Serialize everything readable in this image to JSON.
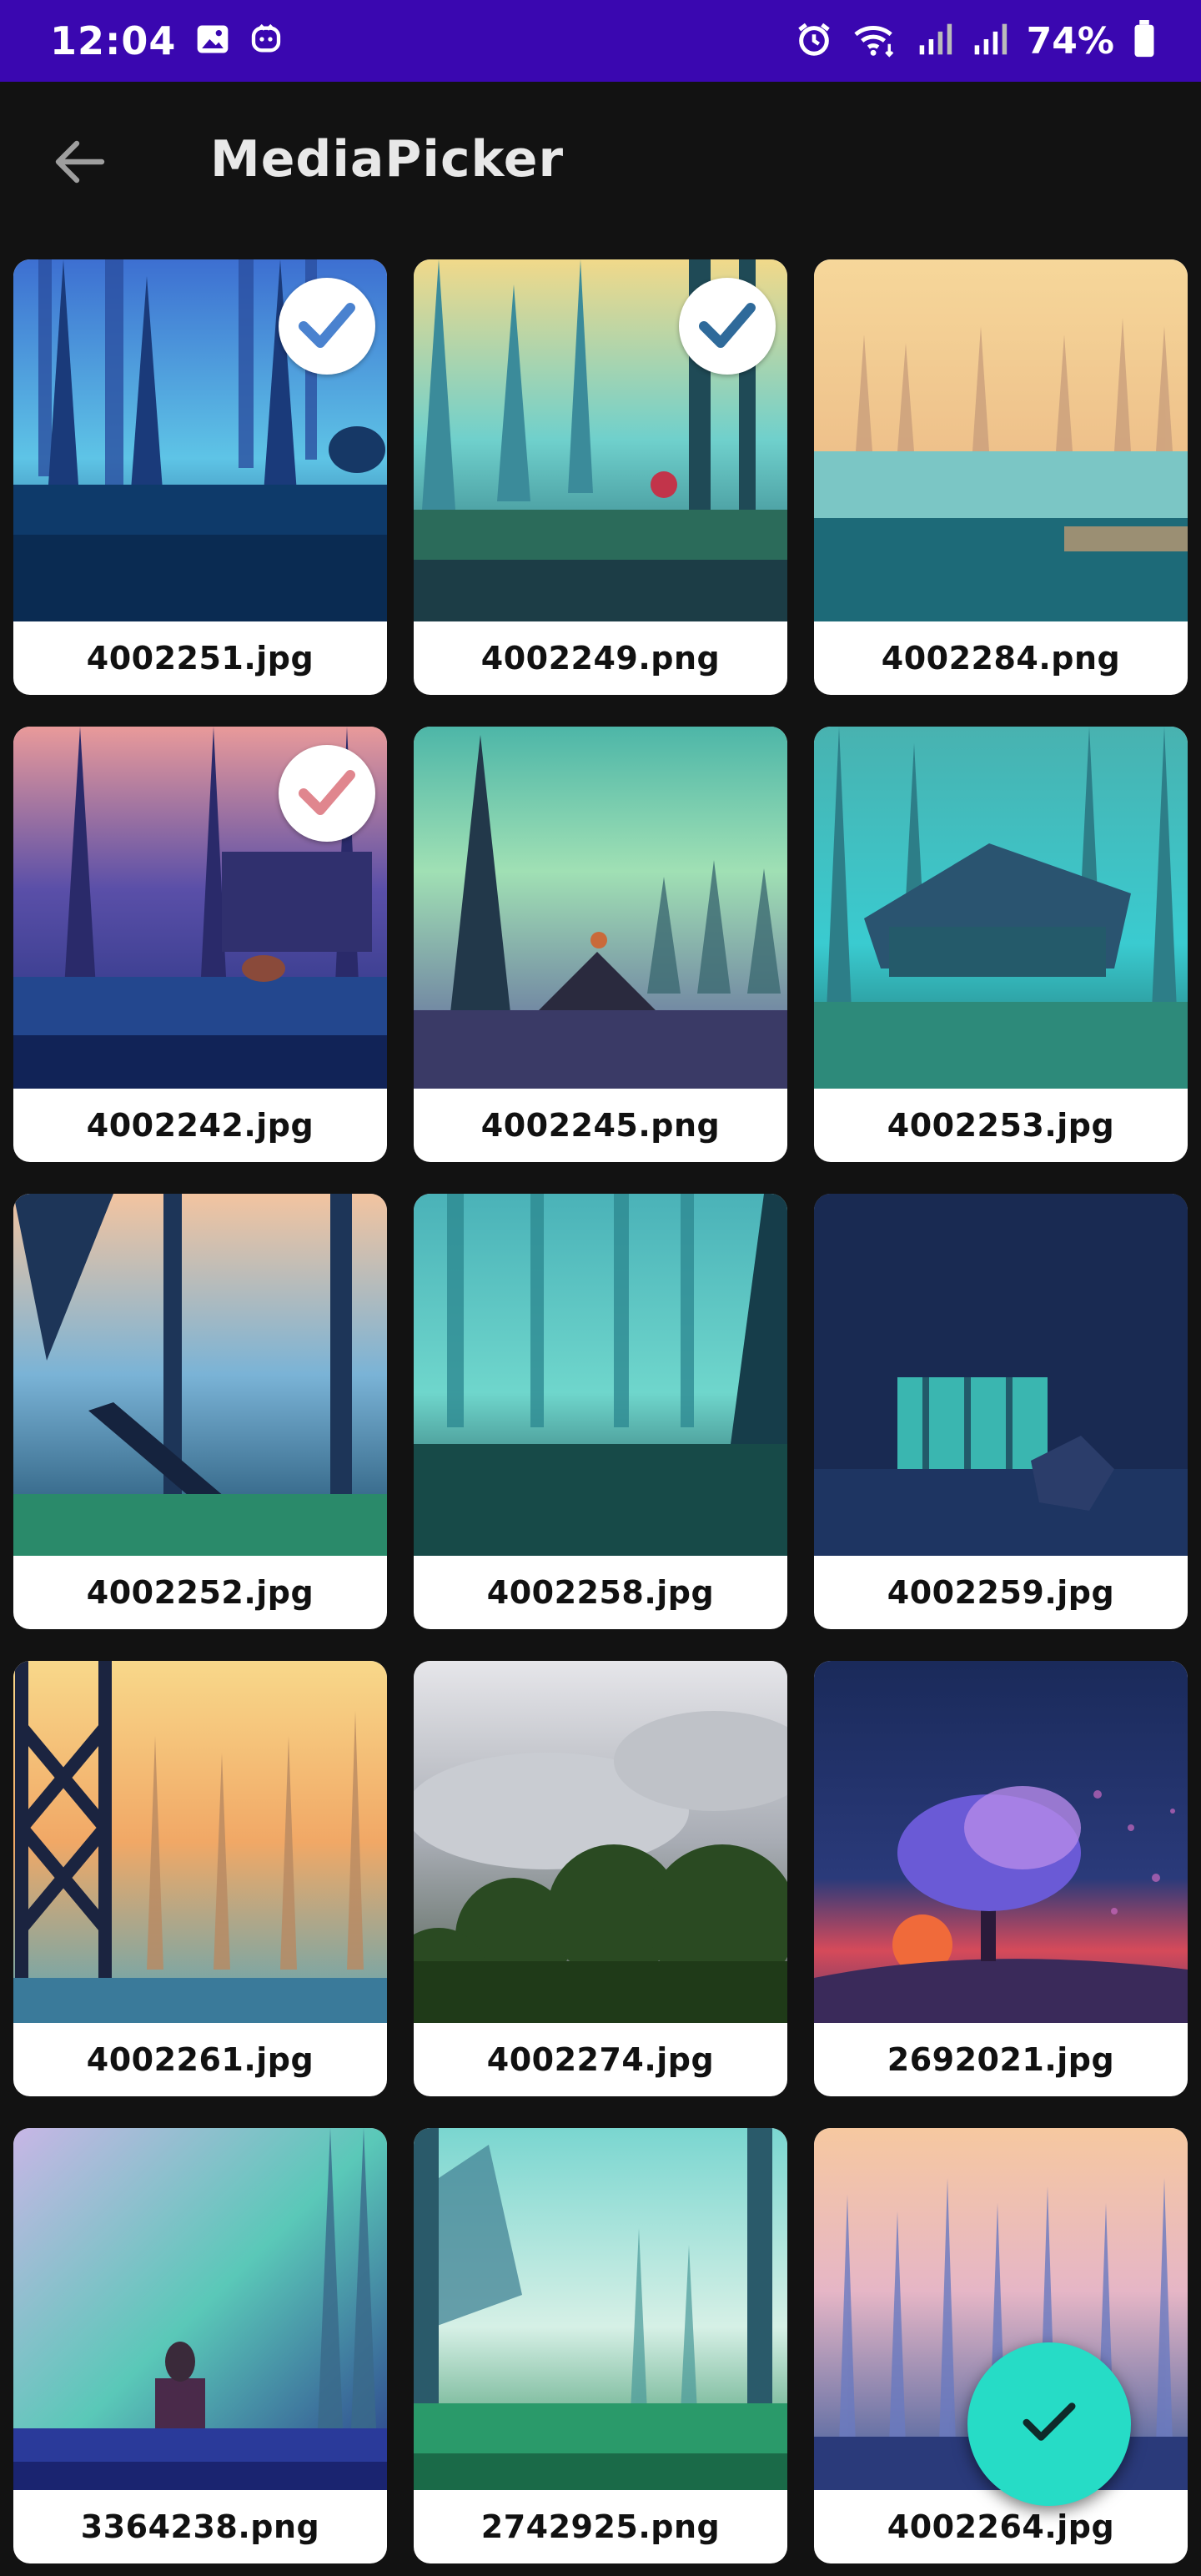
{
  "status_bar": {
    "time": "12:04",
    "battery_percent": "74%",
    "background_color": "#3a07b0",
    "icons": [
      "gallery-icon",
      "assistant-icon",
      "alarm-icon",
      "wifi-icon",
      "signal-icon",
      "signal-icon",
      "battery-icon"
    ]
  },
  "app_bar": {
    "title": "MediaPicker",
    "back_icon": "arrow-left-icon"
  },
  "media_items": [
    {
      "filename": "4002251.jpg",
      "selected": true
    },
    {
      "filename": "4002249.png",
      "selected": true
    },
    {
      "filename": "4002284.png",
      "selected": false
    },
    {
      "filename": "4002242.jpg",
      "selected": true
    },
    {
      "filename": "4002245.png",
      "selected": false
    },
    {
      "filename": "4002253.jpg",
      "selected": false
    },
    {
      "filename": "4002252.jpg",
      "selected": false
    },
    {
      "filename": "4002258.jpg",
      "selected": false
    },
    {
      "filename": "4002259.jpg",
      "selected": false
    },
    {
      "filename": "4002261.jpg",
      "selected": false
    },
    {
      "filename": "4002274.jpg",
      "selected": false
    },
    {
      "filename": "2692021.jpg",
      "selected": false
    },
    {
      "filename": "3364238.png",
      "selected": false
    },
    {
      "filename": "2742925.png",
      "selected": false
    },
    {
      "filename": "4002264.jpg",
      "selected": false
    }
  ],
  "fab": {
    "icon": "check-icon",
    "color": "#26dcc6"
  }
}
